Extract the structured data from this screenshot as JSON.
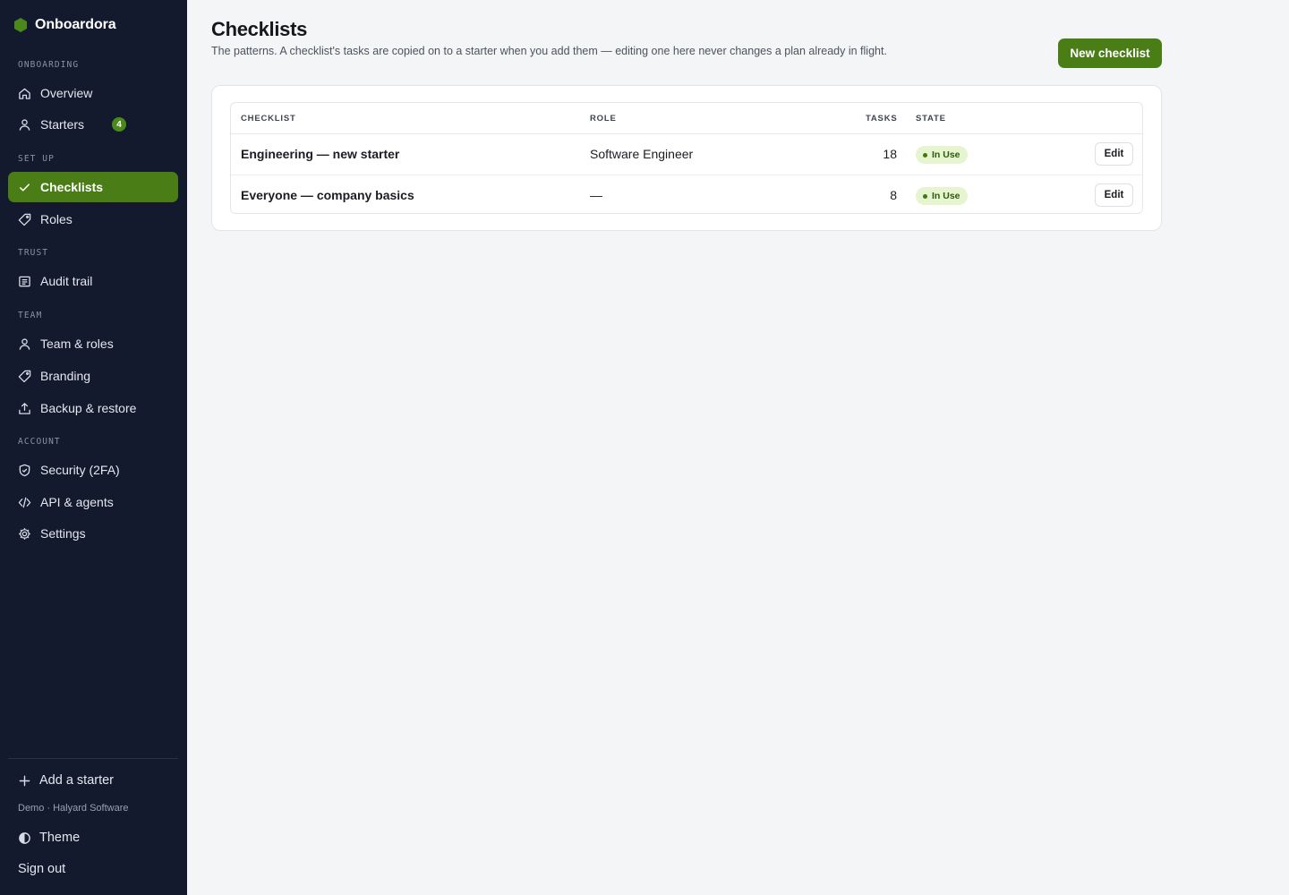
{
  "app": {
    "name": "Onboardora",
    "brand_color": "#4b7d17"
  },
  "sidebar": {
    "sections": {
      "onboarding": "ONBOARDING",
      "setup": "SET UP",
      "trust": "TRUST",
      "team": "TEAM",
      "account": "ACCOUNT"
    },
    "items": {
      "overview": {
        "label": "Overview",
        "icon": "home-icon"
      },
      "starters": {
        "label": "Starters",
        "icon": "person-icon",
        "badge": "4"
      },
      "checklists": {
        "label": "Checklists",
        "icon": "check-icon",
        "active": true
      },
      "roles": {
        "label": "Roles",
        "icon": "tag-icon"
      },
      "audit_trail": {
        "label": "Audit trail",
        "icon": "log-icon"
      },
      "team_roles": {
        "label": "Team & roles",
        "icon": "person-icon"
      },
      "branding": {
        "label": "Branding",
        "icon": "tag-icon"
      },
      "backup_restore": {
        "label": "Backup & restore",
        "icon": "upload-icon"
      },
      "security": {
        "label": "Security (2FA)",
        "icon": "shield-icon"
      },
      "api_agents": {
        "label": "API & agents",
        "icon": "code-icon"
      },
      "settings": {
        "label": "Settings",
        "icon": "gear-icon"
      }
    },
    "footer": {
      "add_starter": "Add a starter",
      "demo": "Demo · Halyard Software",
      "theme": "Theme",
      "sign_out": "Sign out"
    }
  },
  "main": {
    "title": "Checklists",
    "subtitle": "The patterns. A checklist's tasks are copied on to a starter when you add them — editing one here never changes a plan already in flight.",
    "new_button": "New checklist",
    "table": {
      "headers": {
        "checklist": "CHECKLIST",
        "role": "ROLE",
        "tasks": "TASKS",
        "state": "STATE"
      },
      "rows": [
        {
          "name": "Engineering — new starter",
          "role": "Software Engineer",
          "tasks": "18",
          "state": "In Use",
          "action": "Edit"
        },
        {
          "name": "Everyone — company basics",
          "role": "—",
          "tasks": "8",
          "state": "In Use",
          "action": "Edit"
        }
      ]
    }
  }
}
